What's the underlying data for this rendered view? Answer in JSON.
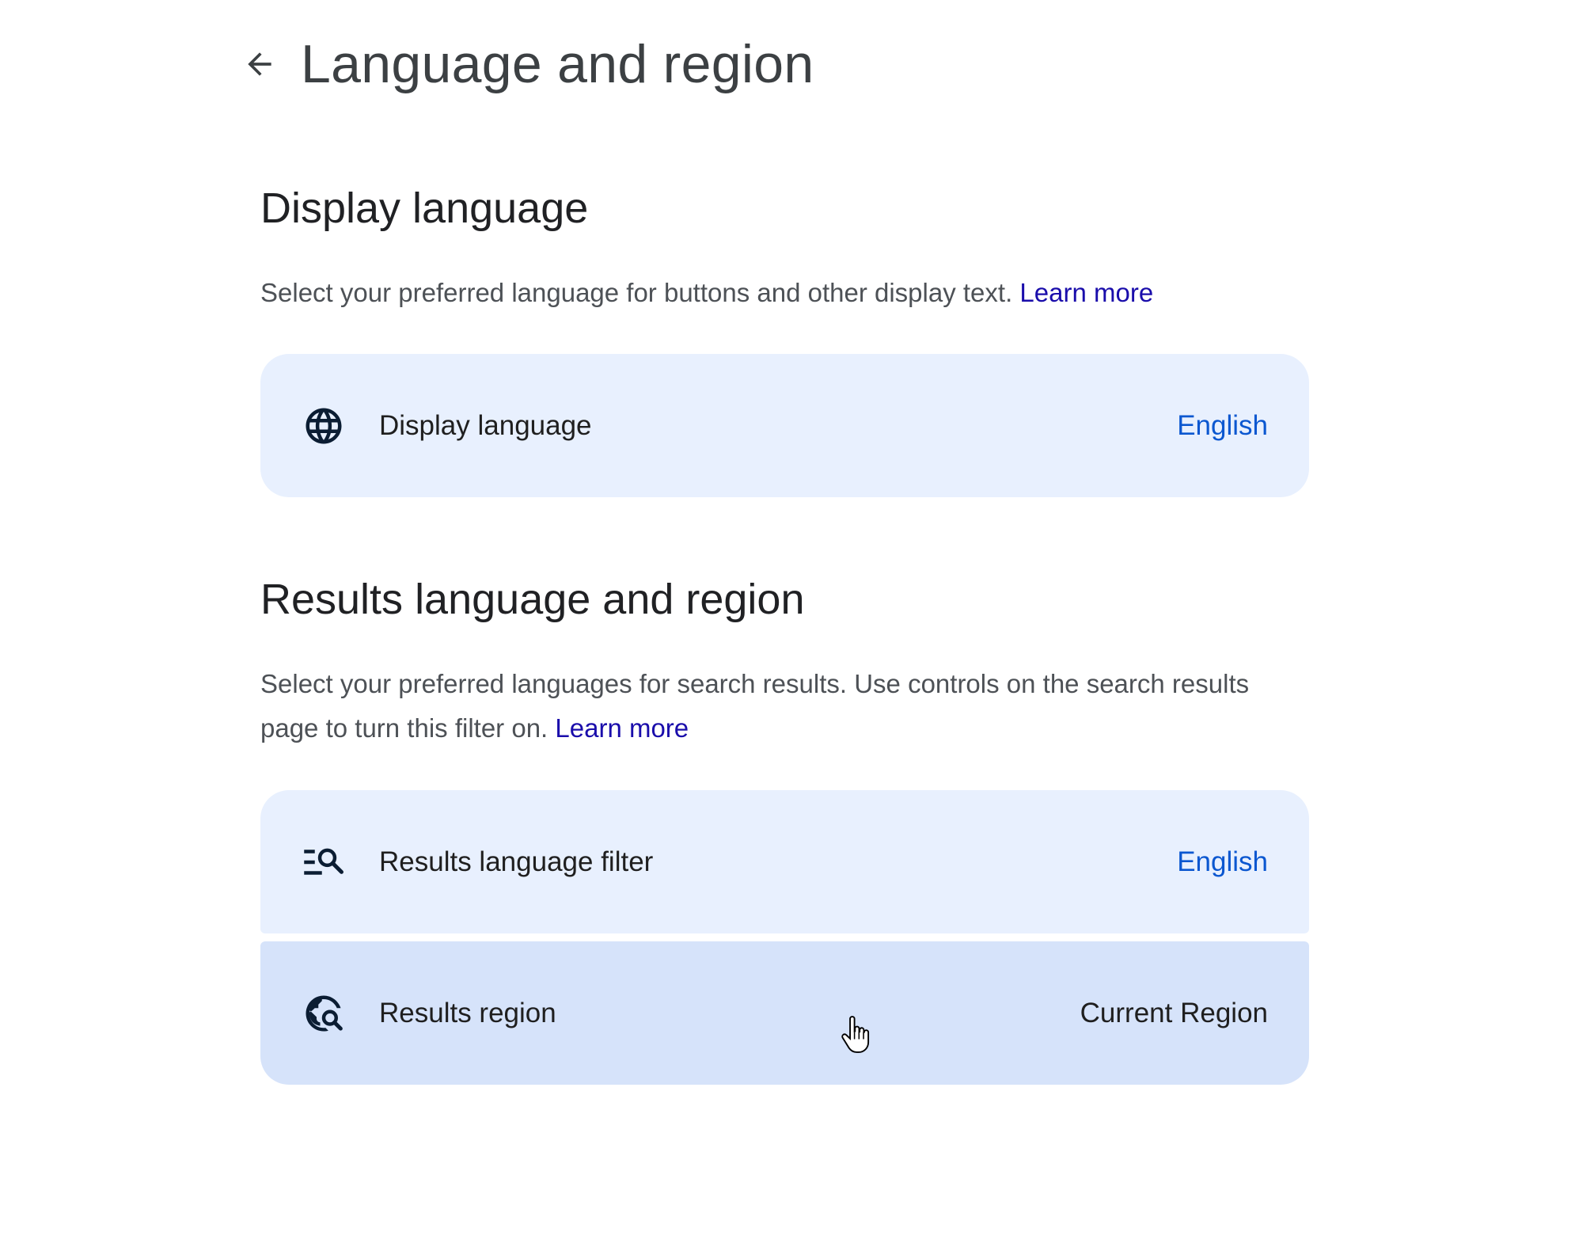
{
  "header": {
    "title": "Language and region"
  },
  "display_section": {
    "title": "Display language",
    "description": "Select your preferred language for buttons and other display text.",
    "learn_more": "Learn more",
    "row": {
      "label": "Display language",
      "value": "English",
      "icon": "globe-icon"
    }
  },
  "results_section": {
    "title": "Results language and region",
    "description": "Select your preferred languages for search results. Use controls on the search results page to turn this filter on.",
    "learn_more": "Learn more",
    "rows": [
      {
        "label": "Results language filter",
        "value": "English",
        "icon": "filter-search-icon"
      },
      {
        "label": "Results region",
        "value": "Current Region",
        "icon": "globe-search-icon"
      }
    ]
  },
  "colors": {
    "row_background": "#e8f0fe",
    "row_hover_background": "#d6e3fa",
    "link": "#1a0dab",
    "value_link": "#0b57d0"
  }
}
